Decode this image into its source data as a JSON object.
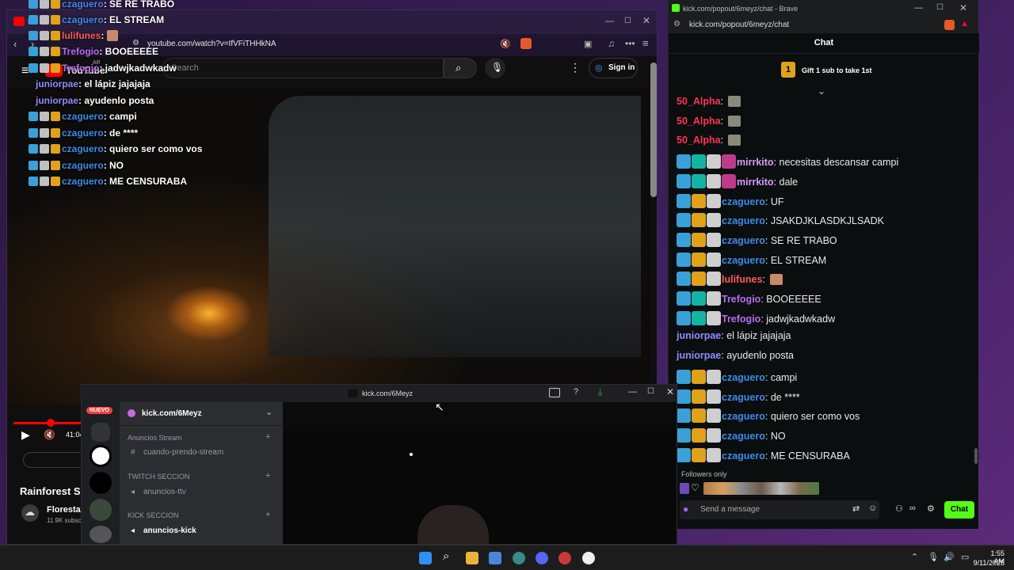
{
  "youtube": {
    "tab_title": "Ra",
    "url": "youtube.com/watch?v=IfVFiTHHkNA",
    "logo": "YouTube",
    "logo_country": "AR",
    "search_placeholder": "Search",
    "sign_in": "Sign in",
    "time": "41:04",
    "video_title": "Rainforest Sh",
    "channel_name": "Floresta",
    "subscribers": "11.9K subsc"
  },
  "overlay_chat": [
    {
      "user": "czaguero",
      "text": ": SE RE TRABO",
      "color": "#3d8be8"
    },
    {
      "user": "czaguero",
      "text": ": EL STREAM",
      "color": "#3d8be8"
    },
    {
      "user": "lulifunes",
      "text": ":",
      "color": "#ff5a5a"
    },
    {
      "user": "Trefogio",
      "text": ": BOOEEEEE",
      "color": "#b86cf0"
    },
    {
      "user": "Trefogio",
      "text": ": jadwjkadwkadw",
      "color": "#b86cf0"
    },
    {
      "user": "juniorpae",
      "text": ": el lápiz jajajaja",
      "color": "#8f8cff"
    },
    {
      "user": "juniorpae",
      "text": ": ayudenlo posta",
      "color": "#8f8cff"
    },
    {
      "user": "czaguero",
      "text": ": campi",
      "color": "#3d8be8"
    },
    {
      "user": "czaguero",
      "text": ": de ****",
      "color": "#3d8be8"
    },
    {
      "user": "czaguero",
      "text": ": quiero ser como vos",
      "color": "#3d8be8"
    },
    {
      "user": "czaguero",
      "text": ": NO",
      "color": "#3d8be8"
    },
    {
      "user": "czaguero",
      "text": ": ME CENSURABA",
      "color": "#3d8be8"
    }
  ],
  "brave": {
    "title": "kick.com/popout/6meyz/chat - Brave",
    "url": "kick.com/popout/6meyz/chat",
    "chat_header": "Chat",
    "gift_rank": "1",
    "gift_text": "Gift 1 sub to take 1st",
    "followers_only": "Followers only",
    "send_placeholder": "Send a message",
    "chat_button": "Chat"
  },
  "kick_chat": [
    {
      "user": "50_Alpha",
      "text": ":",
      "color": "#ff3355"
    },
    {
      "user": "50_Alpha",
      "text": ":",
      "color": "#ff3355"
    },
    {
      "user": "50_Alpha",
      "text": ":",
      "color": "#ff3355"
    },
    {
      "user": "mirrkito",
      "text": ": necesitas descansar campi",
      "color": "#d79cf7"
    },
    {
      "user": "mirrkito",
      "text": ": dale",
      "color": "#d79cf7"
    },
    {
      "user": "czaguero",
      "text": ": UF",
      "color": "#3d8be8"
    },
    {
      "user": "czaguero",
      "text": ": JSAKDJKLASDKJLSADK",
      "color": "#3d8be8"
    },
    {
      "user": "czaguero",
      "text": ": SE RE TRABO",
      "color": "#3d8be8"
    },
    {
      "user": "czaguero",
      "text": ": EL STREAM",
      "color": "#3d8be8"
    },
    {
      "user": "lulifunes",
      "text": ":",
      "color": "#ff5a5a"
    },
    {
      "user": "Trefogio",
      "text": ": BOOEEEEE",
      "color": "#b86cf0"
    },
    {
      "user": "Trefogio",
      "text": ": jadwjkadwkadw",
      "color": "#b86cf0"
    },
    {
      "user": "juniorpae",
      "text": ": el lápiz jajajaja",
      "color": "#8f8cff"
    },
    {
      "user": "juniorpae",
      "text": ": ayudenlo posta",
      "color": "#8f8cff"
    },
    {
      "user": "czaguero",
      "text": ": campi",
      "color": "#3d8be8"
    },
    {
      "user": "czaguero",
      "text": ": de ****",
      "color": "#3d8be8"
    },
    {
      "user": "czaguero",
      "text": ": quiero ser como vos",
      "color": "#3d8be8"
    },
    {
      "user": "czaguero",
      "text": ": NO",
      "color": "#3d8be8"
    },
    {
      "user": "czaguero",
      "text": ": ME CENSURABA",
      "color": "#3d8be8"
    }
  ],
  "discord": {
    "title": "kick.com/6Meyz",
    "new_badge": "NUEVO",
    "server_name": "kick.com/6Meyz",
    "categories": [
      {
        "name": "Anuncios Stream",
        "channel": "cuando-prendo-stream"
      },
      {
        "name": "TWITCH SECCION",
        "channel": "anuncios-ttv"
      },
      {
        "name": "KICK SECCION",
        "channel": "anuncios-kick"
      }
    ]
  },
  "taskbar": {
    "time": "1:55 AM",
    "date": "9/11/2025"
  }
}
